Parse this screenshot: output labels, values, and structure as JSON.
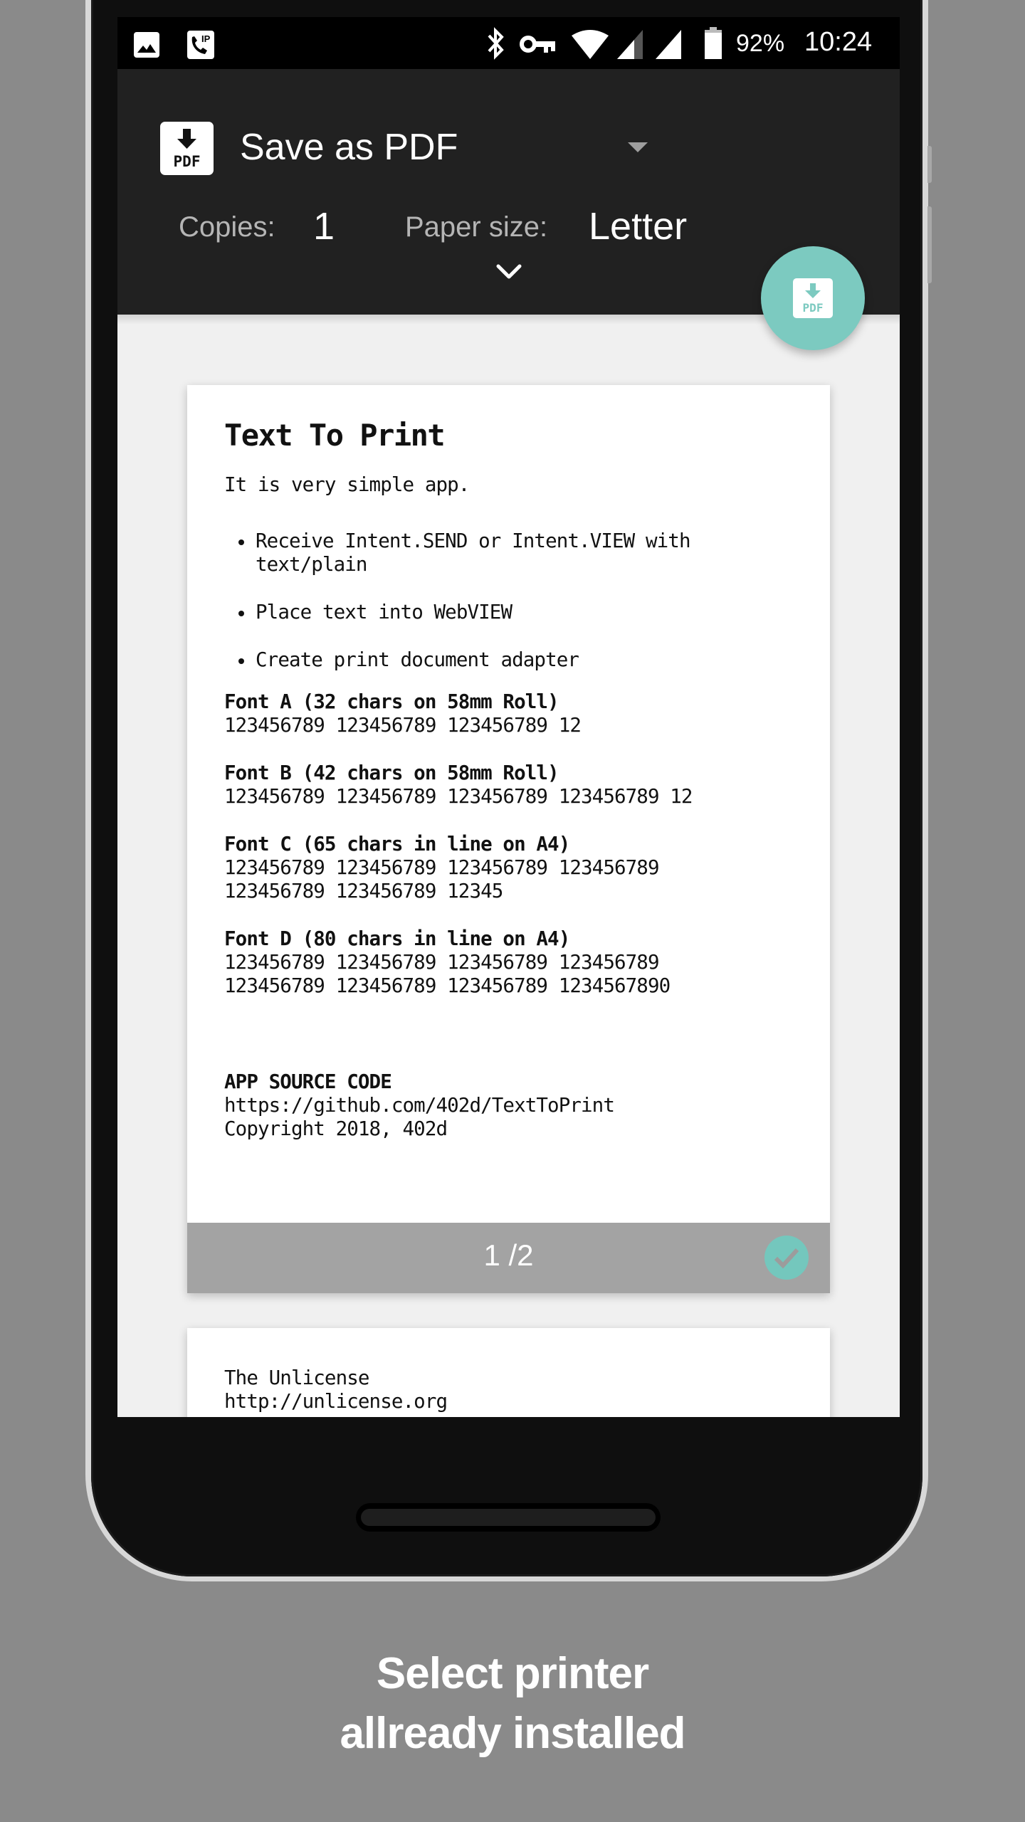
{
  "status_bar": {
    "left_icons": [
      "image-notification-icon",
      "ip-call-icon"
    ],
    "right_icons": [
      "bluetooth-icon",
      "vpn-key-icon",
      "wifi-icon",
      "signal-icon-1",
      "signal-icon-2",
      "battery-icon"
    ],
    "battery": "92%",
    "time": "10:24"
  },
  "print_toolbar": {
    "printer_icon": "pdf-icon",
    "printer_name": "Save as PDF",
    "copies_label": "Copies:",
    "copies_value": "1",
    "paper_size_label": "Paper size:",
    "paper_size_value": "Letter",
    "expand_icon": "chevron-down-icon"
  },
  "fab": {
    "icon": "save-pdf-icon",
    "color": "#7ccac0"
  },
  "preview": {
    "page1": {
      "title": "Text To Print",
      "intro": "It is very simple app.",
      "bullets": [
        "Receive Intent.SEND or Intent.VIEW with text/plain",
        "Place text into WebVIEW",
        "Create print document adapter"
      ],
      "font_blocks": [
        {
          "title": "Font A (32 chars on 58mm Roll)",
          "lines": [
            "123456789 123456789 123456789 12"
          ]
        },
        {
          "title": "Font B (42 chars on 58mm Roll)",
          "lines": [
            "123456789 123456789 123456789 123456789 12"
          ]
        },
        {
          "title": "Font C (65 chars in line on A4)",
          "lines": [
            "123456789 123456789 123456789 123456789",
            "123456789 123456789 12345"
          ]
        },
        {
          "title": "Font D (80 chars in line on A4)",
          "lines": [
            "123456789 123456789 123456789 123456789",
            "123456789 123456789 123456789 1234567890"
          ]
        }
      ],
      "source_title": "APP SOURCE CODE",
      "source_url": "https://github.com/402d/TextToPrint",
      "copyright": "Copyright 2018, 402d",
      "page_indicator": "1 /2",
      "selected": true
    },
    "page2": {
      "lines": [
        "The Unlicense",
        "http://unlicense.org"
      ]
    }
  },
  "caption": {
    "line1": "Select printer",
    "line2": "allready installed"
  }
}
